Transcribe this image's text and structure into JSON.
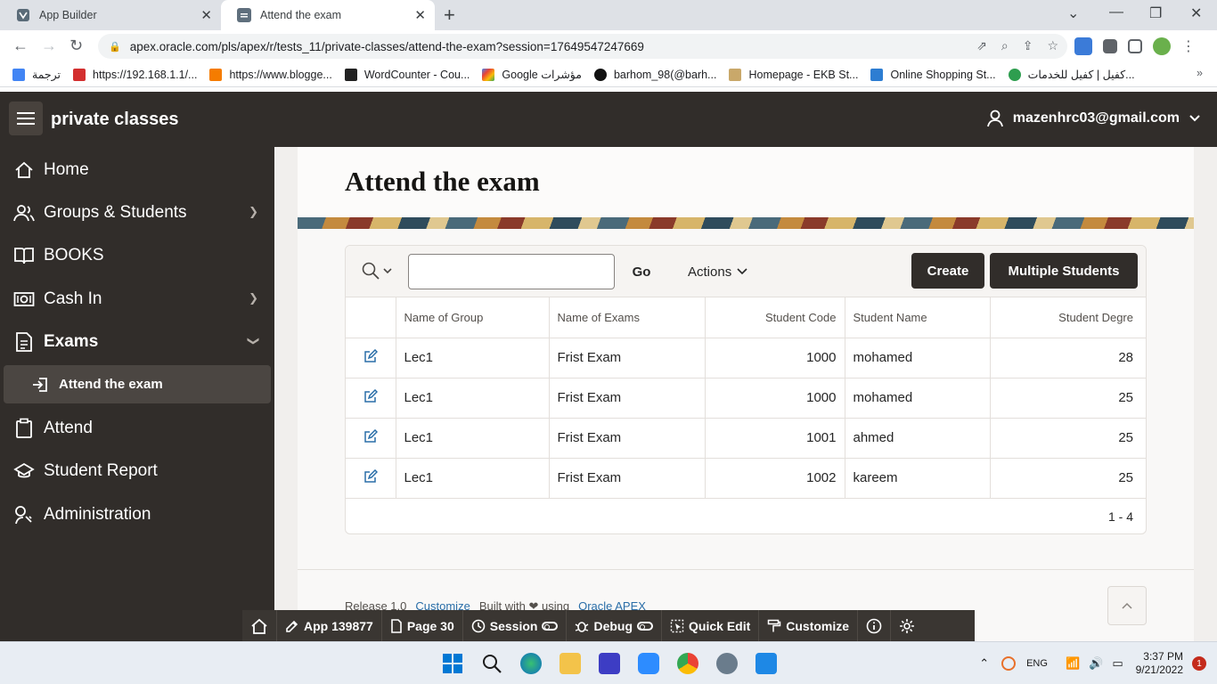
{
  "browser": {
    "tabs": [
      {
        "title": "App Builder",
        "active": false
      },
      {
        "title": "Attend the exam",
        "active": true
      }
    ],
    "url": "apex.oracle.com/pls/apex/r/tests_11/private-classes/attend-the-exam?session=17649547247669",
    "bookmarks": [
      "ترجمة",
      "https://192.168.1.1/...",
      "https://www.blogge...",
      "WordCounter - Cou...",
      "Google مؤشرات",
      "barhom_98(@barh...",
      "Homepage - EKB St...",
      "Online Shopping St...",
      "كفيل | كفيل للخدمات..."
    ]
  },
  "header": {
    "app_name": "private classes",
    "user": "mazenhrc03@gmail.com"
  },
  "sidebar": {
    "items": [
      {
        "label": "Home",
        "icon": "home-icon",
        "has_children": false
      },
      {
        "label": "Groups & Students",
        "icon": "users-icon",
        "has_children": true,
        "expanded": false
      },
      {
        "label": "BOOKS",
        "icon": "book-icon",
        "has_children": false
      },
      {
        "label": "Cash In",
        "icon": "cash-icon",
        "has_children": true,
        "expanded": false
      },
      {
        "label": "Exams",
        "icon": "document-icon",
        "has_children": true,
        "expanded": true
      },
      {
        "label": "Attend",
        "icon": "clipboard-icon",
        "has_children": false
      },
      {
        "label": "Student Report",
        "icon": "report-icon",
        "has_children": false
      },
      {
        "label": "Administration",
        "icon": "wrench-icon",
        "has_children": false
      }
    ],
    "sub_item": {
      "label": "Attend the exam",
      "icon": "sign-in-icon",
      "selected": true
    }
  },
  "page": {
    "title": "Attend the exam"
  },
  "report": {
    "search": {
      "value": "",
      "placeholder": ""
    },
    "go_label": "Go",
    "actions_label": "Actions",
    "create_label": "Create",
    "multiple_label": "Multiple Students",
    "columns": [
      "Name of Group",
      "Name of Exams",
      "Student Code",
      "Student Name",
      "Student Degre"
    ],
    "rows": [
      {
        "group": "Lec1",
        "exam": "Frist Exam",
        "code": "1000",
        "name": "mohamed",
        "degree": "28"
      },
      {
        "group": "Lec1",
        "exam": "Frist Exam",
        "code": "1000",
        "name": "mohamed",
        "degree": "25"
      },
      {
        "group": "Lec1",
        "exam": "Frist Exam",
        "code": "1001",
        "name": "ahmed",
        "degree": "25"
      },
      {
        "group": "Lec1",
        "exam": "Frist Exam",
        "code": "1002",
        "name": "kareem",
        "degree": "25"
      }
    ],
    "pagination": "1 - 4"
  },
  "footer": {
    "release": "Release 1.0",
    "customize": "Customize",
    "built_with": "Built with",
    "using": "using",
    "oracle_apex": "Oracle APEX"
  },
  "dev_toolbar": {
    "app": "App 139877",
    "page": "Page 30",
    "session": "Session",
    "debug": "Debug",
    "quick_edit": "Quick Edit",
    "customize": "Customize"
  },
  "taskbar": {
    "lang": "ENG",
    "time": "3:37 PM",
    "date": "9/21/2022",
    "notifications": "1"
  },
  "colors": {
    "header_bg": "#312d2a",
    "sidebar_selected": "#4b4642",
    "link": "#2a6ea8"
  }
}
